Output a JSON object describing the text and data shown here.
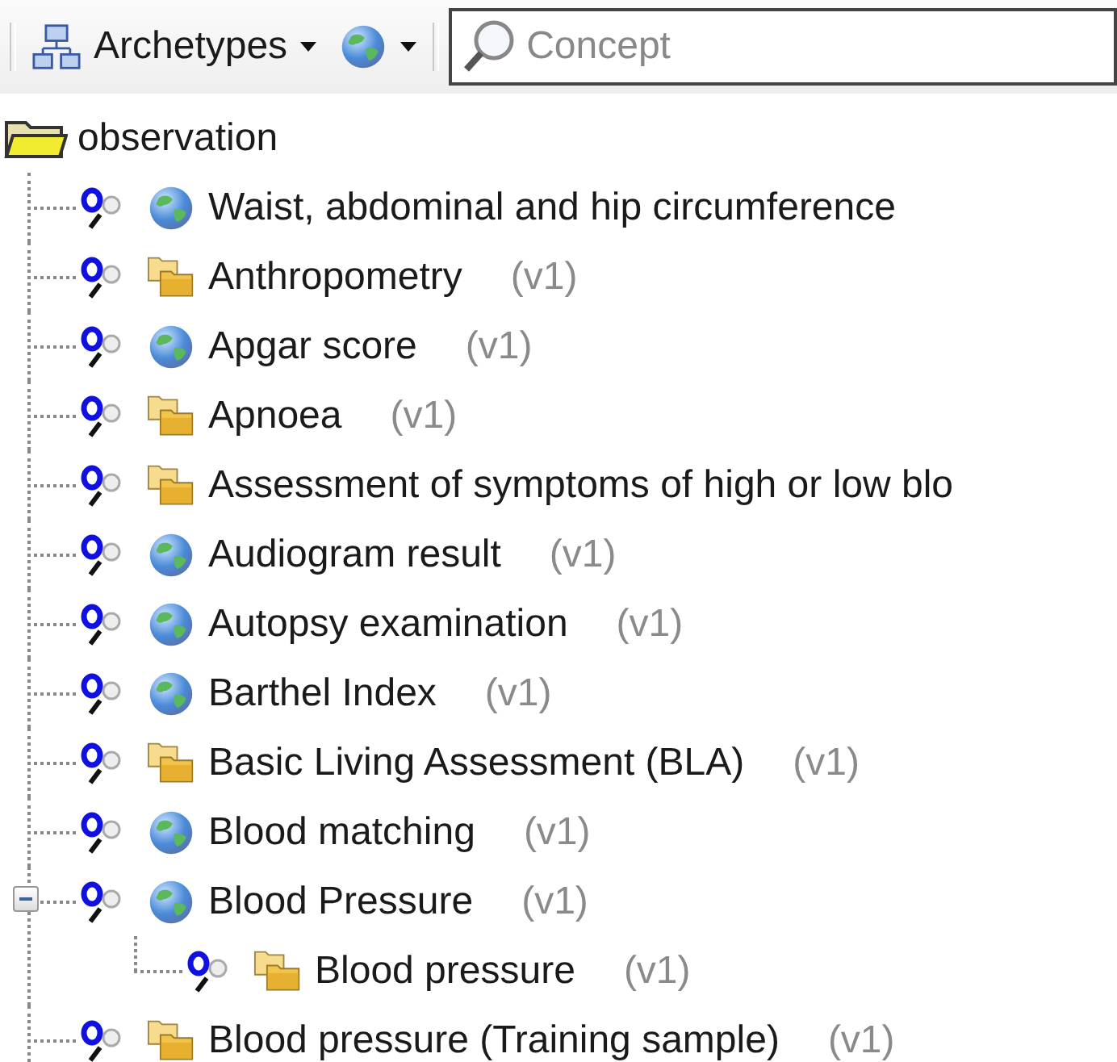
{
  "toolbar": {
    "archetypes_button": "Archetypes",
    "search": {
      "placeholder": "Concept"
    }
  },
  "tree": {
    "label": "observation",
    "children": [
      {
        "kind": "globe",
        "name": "Waist, abdominal and hip circumference"
      },
      {
        "kind": "folders",
        "name": "Anthropometry",
        "version": "(v1)"
      },
      {
        "kind": "globe",
        "name": "Apgar score",
        "version": "(v1)"
      },
      {
        "kind": "folders",
        "name": "Apnoea",
        "version": "(v1)"
      },
      {
        "kind": "folders",
        "name": "Assessment of symptoms of high or low blo"
      },
      {
        "kind": "globe",
        "name": "Audiogram result",
        "version": "(v1)"
      },
      {
        "kind": "globe",
        "name": "Autopsy examination",
        "version": "(v1)"
      },
      {
        "kind": "globe",
        "name": "Barthel Index",
        "version": "(v1)"
      },
      {
        "kind": "folders",
        "name": "Basic Living Assessment (BLA)",
        "version": "(v1)"
      },
      {
        "kind": "globe",
        "name": "Blood matching",
        "version": "(v1)"
      },
      {
        "kind": "globe",
        "name": "Blood Pressure",
        "version": "(v1)",
        "expanded": true,
        "children": [
          {
            "kind": "folders",
            "name": "Blood pressure",
            "version": "(v1)"
          }
        ]
      },
      {
        "kind": "folders",
        "name": "Blood pressure (Training sample)",
        "version": "(v1)"
      }
    ]
  }
}
